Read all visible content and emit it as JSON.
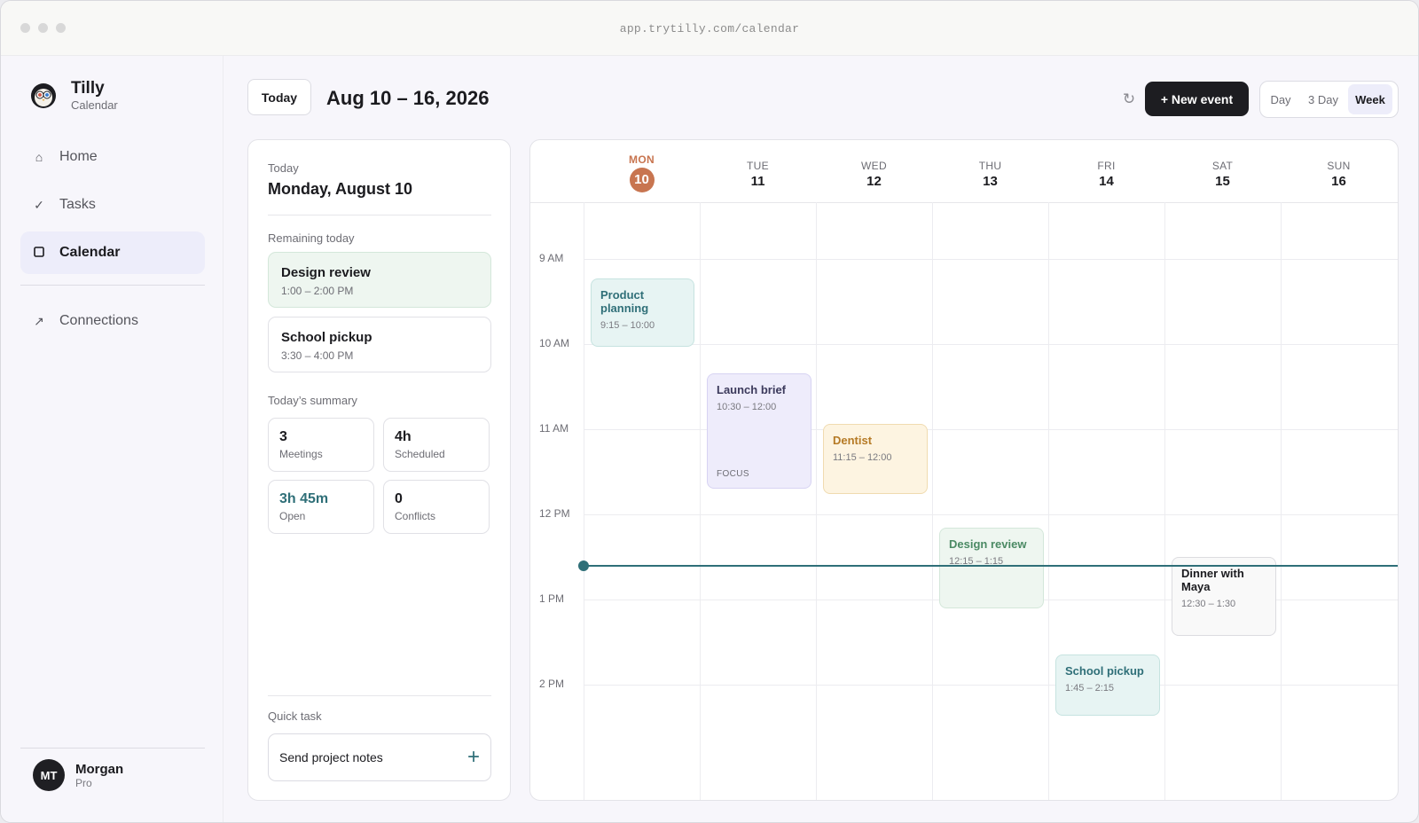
{
  "browser": {
    "url": "app.trytilly.com/calendar"
  },
  "brand": {
    "name": "Tilly",
    "subtitle": "Calendar",
    "logo_icon": "owl-icon"
  },
  "nav": {
    "items": [
      {
        "label": "Home",
        "icon": "home-icon",
        "active": false
      },
      {
        "label": "Tasks",
        "icon": "check-icon",
        "active": false
      },
      {
        "label": "Calendar",
        "icon": "square-icon",
        "active": true
      }
    ],
    "secondary": [
      {
        "label": "Connections",
        "icon": "arrow-up-right-icon"
      }
    ]
  },
  "user": {
    "initials": "MT",
    "name": "Morgan",
    "plan": "Pro"
  },
  "header": {
    "today_button": "Today",
    "range": "Aug 10 – 16, 2026",
    "refresh_icon": "refresh-icon",
    "new_event_button": "+ New event",
    "views": [
      "Day",
      "3 Day",
      "Week"
    ],
    "active_view": "Week"
  },
  "today_panel": {
    "label": "Today",
    "date": "Monday, August 10",
    "remaining_label": "Remaining today",
    "remaining": [
      {
        "title": "Design review",
        "time": "1:00 – 2:00 PM"
      },
      {
        "title": "School pickup",
        "time": "3:30 – 4:00 PM"
      }
    ],
    "summary_label": "Today’s summary",
    "stats": [
      {
        "value": "3",
        "label": "Meetings"
      },
      {
        "value": "4h",
        "label": "Scheduled"
      },
      {
        "value": "3h 45m",
        "label": "Open"
      },
      {
        "value": "0",
        "label": "Conflicts"
      }
    ],
    "quick_task_label": "Quick task",
    "quick_task_value": "Send project notes",
    "quick_task_add_icon": "plus-icon"
  },
  "calendar": {
    "days": [
      {
        "dow": "MON",
        "date": "10",
        "current": true
      },
      {
        "dow": "TUE",
        "date": "11"
      },
      {
        "dow": "WED",
        "date": "12"
      },
      {
        "dow": "THU",
        "date": "13"
      },
      {
        "dow": "FRI",
        "date": "14"
      },
      {
        "dow": "SAT",
        "date": "15"
      },
      {
        "dow": "SUN",
        "date": "16"
      }
    ],
    "hours": [
      "9 AM",
      "10 AM",
      "11 AM",
      "12 PM",
      "1 PM",
      "2 PM"
    ],
    "events": [
      {
        "title": "Product planning",
        "time": "9:15 – 10:00",
        "day": "MON",
        "color": "teal"
      },
      {
        "title": "Launch brief",
        "time": "10:30 – 12:00",
        "tag": "FOCUS",
        "day": "TUE",
        "color": "purple"
      },
      {
        "title": "Dentist",
        "time": "11:15 – 12:00",
        "day": "WED",
        "color": "yellow"
      },
      {
        "title": "Design review",
        "time": "12:15 – 1:15",
        "day": "THU",
        "color": "green"
      },
      {
        "title": "School pickup",
        "time": "1:45 – 2:15",
        "day": "FRI",
        "color": "teal"
      },
      {
        "title": "Dinner with Maya",
        "time": "12:30 – 1:30",
        "day": "SAT",
        "color": "white"
      }
    ]
  },
  "colors": {
    "accent": "#2f6f78",
    "current_day": "#c87550",
    "primary_button": "#1d1d21"
  }
}
